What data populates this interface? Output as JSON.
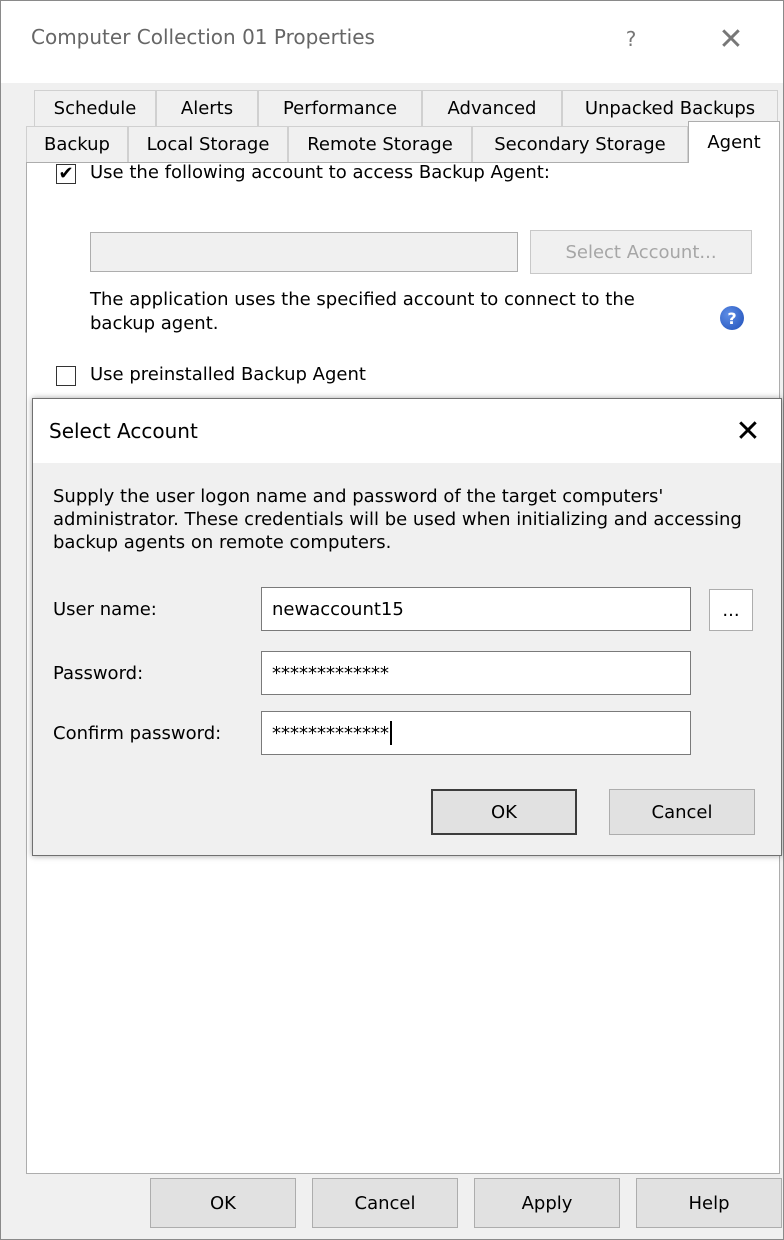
{
  "window": {
    "title": "Computer Collection 01 Properties",
    "help_glyph": "?",
    "close_glyph": "✕"
  },
  "tabs": {
    "row1": [
      "Schedule",
      "Alerts",
      "Performance",
      "Advanced",
      "Unpacked Backups"
    ],
    "row2": [
      "Backup",
      "Local Storage",
      "Remote Storage",
      "Secondary Storage",
      "Agent"
    ],
    "active": "Agent"
  },
  "agent_tab": {
    "use_account_label": "Use the following account to access Backup Agent:",
    "use_account_checked": true,
    "account_value": "",
    "select_account_button": "Select Account...",
    "info_text": "The application uses the specified account to connect to the backup agent.",
    "help_icon_glyph": "?",
    "use_preinstalled_label": "Use preinstalled Backup Agent",
    "use_preinstalled_checked": false,
    "check_glyph": "✔"
  },
  "select_account_dialog": {
    "title": "Select Account",
    "close_glyph": "✕",
    "description": "Supply the user logon name and password of the target computers' administrator. These credentials will be used when initializing and accessing backup agents on remote computers.",
    "user_name_label": "User name:",
    "user_name_value": "newaccount15",
    "browse_button": "...",
    "password_label": "Password:",
    "password_value": "*************",
    "confirm_label": "Confirm password:",
    "confirm_value": "*************",
    "ok_button": "OK",
    "cancel_button": "Cancel"
  },
  "bottom_buttons": {
    "ok": "OK",
    "cancel": "Cancel",
    "apply": "Apply",
    "help": "Help"
  }
}
